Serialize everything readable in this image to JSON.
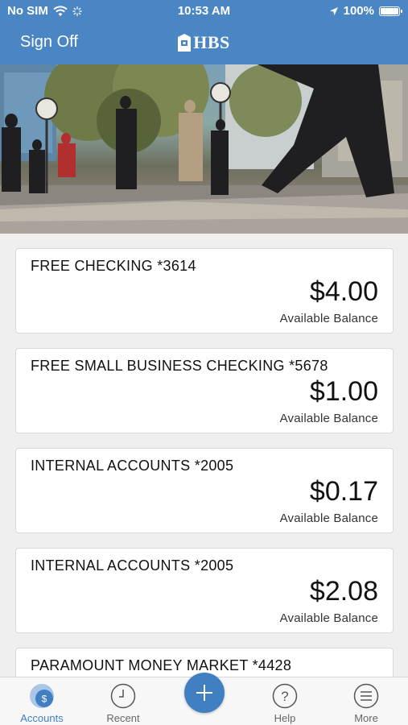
{
  "status_bar": {
    "carrier": "No SIM",
    "time": "10:53 AM",
    "battery": "100%"
  },
  "nav": {
    "sign_off_label": "Sign Off",
    "logo_text": "HBS"
  },
  "accounts": [
    {
      "name": "FREE CHECKING *3614",
      "amount": "$4.00",
      "label": "Available Balance"
    },
    {
      "name": "FREE SMALL BUSINESS CHECKING *5678",
      "amount": "$1.00",
      "label": "Available Balance"
    },
    {
      "name": "INTERNAL ACCOUNTS *2005",
      "amount": "$0.17",
      "label": "Available Balance"
    },
    {
      "name": "INTERNAL ACCOUNTS *2005",
      "amount": "$2.08",
      "label": "Available Balance"
    },
    {
      "name": "PARAMOUNT MONEY MARKET *4428",
      "amount": "",
      "label": ""
    }
  ],
  "tabs": {
    "accounts": "Accounts",
    "recent": "Recent",
    "help": "Help",
    "more": "More"
  },
  "colors": {
    "header": "#4a86c3",
    "accent": "#3f7fc2"
  }
}
